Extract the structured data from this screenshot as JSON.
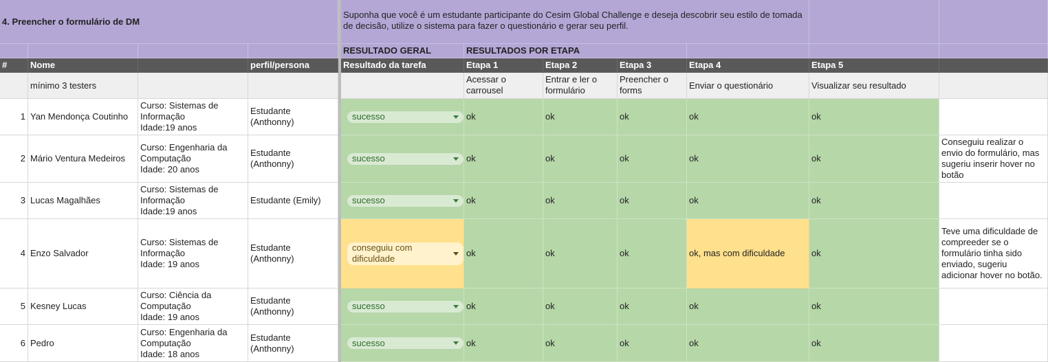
{
  "section_title": "4. Preencher o formulário de DM",
  "scenario": "Suponha que você é um estudante participante do Cesim Global Challenge e deseja descobrir seu estilo de tomada de decisão, utilize o sistema para fazer o questionário e gerar seu perfil.",
  "group_headers": {
    "overall": "RESULTADO GERAL",
    "by_step": "RESULTADOS POR ETAPA"
  },
  "columns": {
    "index": "#",
    "name": "Nome",
    "persona": "perfil/persona",
    "task_result": "Resultado da tarefa",
    "step1": "Etapa 1",
    "step2": "Etapa 2",
    "step3": "Etapa 3",
    "step4": "Etapa 4",
    "step5": "Etapa 5"
  },
  "descriptions": {
    "name_note": "mínimo 3 testers",
    "step1": "Acessar o carrousel",
    "step2": "Entrar e ler o formulário",
    "step3": "Preencher o forms",
    "step4": "Enviar o questionário",
    "step5": "Visualizar seu resultado"
  },
  "status_colors": {
    "success": "#b6d7a8",
    "difficulty": "#ffe08c",
    "header": "#b4a7d6",
    "column_header": "#595959"
  },
  "rows": [
    {
      "index": "1",
      "name": "Yan Mendonça Coutinho",
      "info_course": "Curso: Sistemas de Informação",
      "info_age": "Idade:19 anos",
      "persona": "Estudante (Anthonny)",
      "result": "sucesso",
      "steps": [
        "ok",
        "ok",
        "ok",
        "ok",
        "ok"
      ],
      "comment": ""
    },
    {
      "index": "2",
      "name": "Mário Ventura Medeiros",
      "info_course": "Curso: Engenharia da Computação",
      "info_age": "Idade:  20 anos",
      "persona": "Estudante (Anthonny)",
      "result": "sucesso",
      "steps": [
        "ok",
        "ok",
        "ok",
        "ok",
        "ok"
      ],
      "comment": "Conseguiu realizar o envio do formulário, mas sugeriu inserir hover no botão"
    },
    {
      "index": "3",
      "name": "Lucas Magalhães",
      "info_course": "Curso: Sistemas de Informação",
      "info_age": "Idade:19 anos",
      "persona": "Estudante (Emily)",
      "result": "sucesso",
      "steps": [
        "ok",
        "ok",
        "ok",
        "ok",
        "ok"
      ],
      "comment": ""
    },
    {
      "index": "4",
      "name": "Enzo Salvador",
      "info_course": "Curso: Sistemas de Informação",
      "info_age": "Idade: 19 anos",
      "persona": "Estudante (Anthonny)",
      "result": "conseguiu com dificuldade",
      "steps": [
        "ok",
        "ok",
        "ok",
        "ok, mas com dificuldade",
        "ok"
      ],
      "comment": "Teve uma dificuldade de compreeder se o formulário tinha sido enviado, sugeriu adicionar hover no botão."
    },
    {
      "index": "5",
      "name": "Kesney Lucas",
      "info_course": "Curso: Ciência da Computação",
      "info_age": "Idade: 19 anos",
      "persona": "Estudante (Anthonny)",
      "result": "sucesso",
      "steps": [
        "ok",
        "ok",
        "ok",
        "ok",
        "ok"
      ],
      "comment": ""
    },
    {
      "index": "6",
      "name": "Pedro",
      "info_course": "Curso: Engenharia da Computação",
      "info_age": "Idade:  18 anos",
      "persona": "Estudante (Anthonny)",
      "result": "sucesso",
      "steps": [
        "ok",
        "ok",
        "ok",
        "ok",
        "ok"
      ],
      "comment": ""
    }
  ]
}
